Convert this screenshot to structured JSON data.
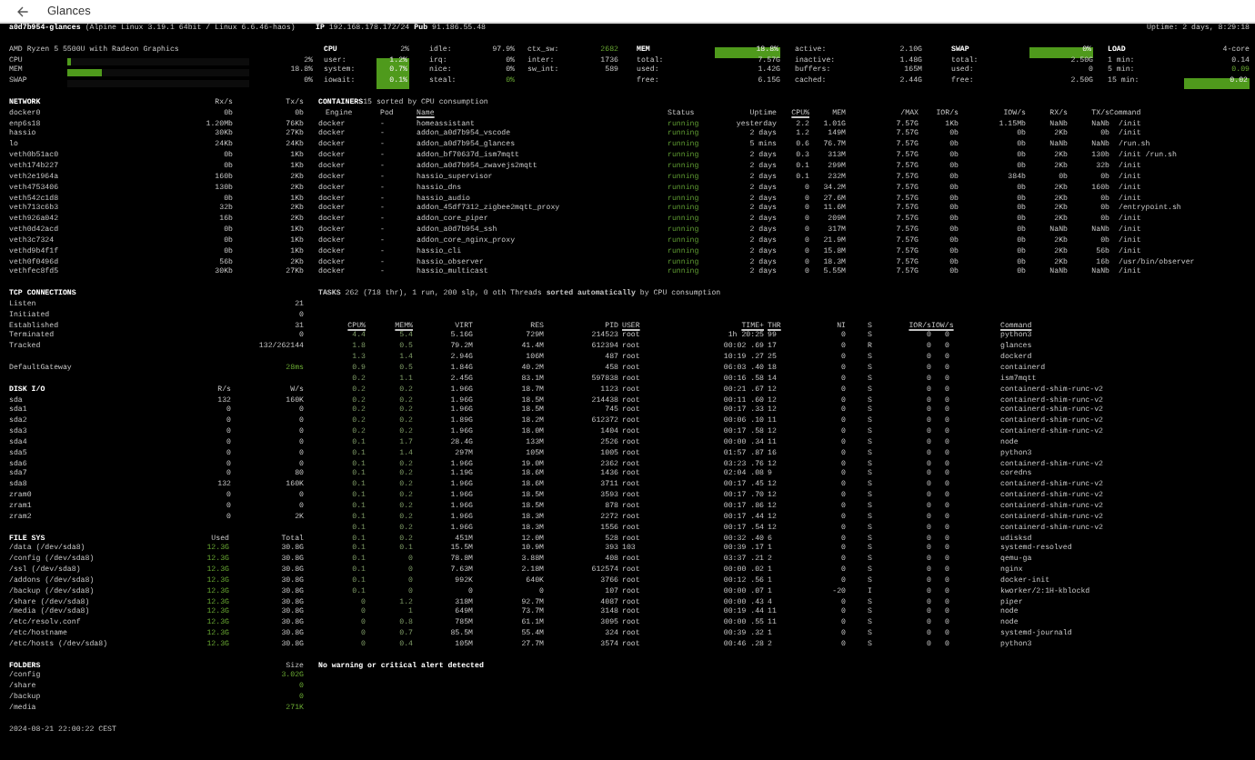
{
  "window": {
    "title": "Glances"
  },
  "header": {
    "hostname": "a0d7b954-glances",
    "os": "(Alpine Linux 3.19.1 64bit / Linux 6.6.46-haos)",
    "ip_label": "IP",
    "ip": "192.168.178.172/24",
    "pub_label": "Pub",
    "pub": "91.186.55.48",
    "uptime": "Uptime: 2 days, 8:29:18"
  },
  "quicklook": {
    "cpu_model": "AMD Ryzen 5 5500U with Radeon Graphics",
    "bars": [
      {
        "label": "CPU",
        "level": 0.02,
        "value": "2%"
      },
      {
        "label": "MEM",
        "level": 0.188,
        "value": "18.8%"
      },
      {
        "label": "SWAP",
        "level": 0,
        "value": "0%"
      }
    ]
  },
  "stats": [
    {
      "rows": [
        {
          "label": "CPU",
          "value": "2%",
          "kind": "plain",
          "heading": true
        },
        {
          "label": "user:",
          "value": "1.2%",
          "kind": "fill"
        },
        {
          "label": "system:",
          "value": "0.7%",
          "kind": "fill"
        },
        {
          "label": "iowait:",
          "value": "0.1%",
          "kind": "fill"
        }
      ]
    },
    {
      "rows": [
        {
          "label": "idle:",
          "value": "97.9%",
          "kind": "plain"
        },
        {
          "label": "irq:",
          "value": "0%",
          "kind": "plain"
        },
        {
          "label": "nice:",
          "value": "0%",
          "kind": "plain"
        },
        {
          "label": "steal:",
          "value": "0%",
          "kind": "ok"
        }
      ]
    },
    {
      "rows": [
        {
          "label": "ctx_sw:",
          "value": "2682",
          "kind": "ok"
        },
        {
          "label": "inter:",
          "value": "1736",
          "kind": "plain"
        },
        {
          "label": "sw_int:",
          "value": "589",
          "kind": "plain"
        }
      ]
    },
    {
      "rows": [
        {
          "label": "MEM",
          "value": "18.8%",
          "kind": "fill",
          "heading": true
        },
        {
          "label": "total:",
          "value": "7.57G",
          "kind": "plain"
        },
        {
          "label": "used:",
          "value": "1.42G",
          "kind": "plain"
        },
        {
          "label": "free:",
          "value": "6.15G",
          "kind": "plain"
        }
      ]
    },
    {
      "rows": [
        {
          "label": "active:",
          "value": "2.10G",
          "kind": "plain"
        },
        {
          "label": "inactive:",
          "value": "1.48G",
          "kind": "plain"
        },
        {
          "label": "buffers:",
          "value": "165M",
          "kind": "plain"
        },
        {
          "label": "cached:",
          "value": "2.44G",
          "kind": "plain"
        }
      ]
    },
    {
      "rows": [
        {
          "label": "SWAP",
          "value": "0%",
          "kind": "fill",
          "heading": true
        },
        {
          "label": "total:",
          "value": "2.50G",
          "kind": "plain"
        },
        {
          "label": "used:",
          "value": "0",
          "kind": "plain"
        },
        {
          "label": "free:",
          "value": "2.50G",
          "kind": "plain"
        }
      ]
    },
    {
      "rows": [
        {
          "label": "LOAD",
          "value": "4-core",
          "kind": "plain",
          "heading": true
        },
        {
          "label": "1 min:",
          "value": "0.14",
          "kind": "plain"
        },
        {
          "label": "5 min:",
          "value": "0.09",
          "kind": "ok"
        },
        {
          "label": "15 min:",
          "value": "0.02",
          "kind": "fill"
        }
      ]
    }
  ],
  "network": {
    "columns": [
      "NETWORK",
      "Rx/s",
      "Tx/s"
    ],
    "rows": [
      [
        "docker0",
        "0b",
        "0b"
      ],
      [
        "enp6s18",
        "1.20Mb",
        "76Kb"
      ],
      [
        "hassio",
        "30Kb",
        "27Kb"
      ],
      [
        "lo",
        "24Kb",
        "24Kb"
      ],
      [
        "veth0b51ac0",
        "0b",
        "1Kb"
      ],
      [
        "veth174b227",
        "0b",
        "1Kb"
      ],
      [
        "veth2e1964a",
        "160b",
        "2Kb"
      ],
      [
        "veth4753406",
        "130b",
        "2Kb"
      ],
      [
        "veth542c1d8",
        "0b",
        "1Kb"
      ],
      [
        "veth713c6b3",
        "32b",
        "2Kb"
      ],
      [
        "veth926a042",
        "16b",
        "2Kb"
      ],
      [
        "veth0d42acd",
        "0b",
        "1Kb"
      ],
      [
        "veth3c7324",
        "0b",
        "1Kb"
      ],
      [
        "vethd9b4f1f",
        "0b",
        "1Kb"
      ],
      [
        "veth0f0496d",
        "56b",
        "2Kb"
      ],
      [
        "vethfec8fd5",
        "30Kb",
        "27Kb"
      ]
    ]
  },
  "containers": {
    "title": "CONTAINERS",
    "summary": "15 sorted by CPU consumption",
    "columns": [
      {
        "label": "Engine",
        "underlined": false
      },
      {
        "label": "Pod",
        "underlined": false
      },
      {
        "label": "Name",
        "underlined": true
      },
      {
        "label": "Status",
        "underlined": false
      },
      {
        "label": "Uptime",
        "underlined": false
      },
      {
        "label": "CPU%",
        "underlined": true
      },
      {
        "label": "MEM",
        "underlined": false
      },
      {
        "label": "/MAX",
        "underlined": false
      },
      {
        "label": "IOR/s",
        "underlined": false
      },
      {
        "label": "IOW/s",
        "underlined": false
      },
      {
        "label": "RX/s",
        "underlined": false
      },
      {
        "label": "TX/s",
        "underlined": false
      },
      {
        "label": "Command",
        "underlined": false
      }
    ],
    "rows": [
      [
        "docker",
        "-",
        "homeassistant",
        "running",
        "yesterday",
        "2.2",
        "1.01G",
        "7.57G",
        "1Kb",
        "1.15Mb",
        "NaNb",
        "NaNb",
        "/init"
      ],
      [
        "docker",
        "-",
        "addon_a0d7b954_vscode",
        "running",
        "2 days",
        "1.2",
        "149M",
        "7.57G",
        "0b",
        "0b",
        "2Kb",
        "0b",
        "/init"
      ],
      [
        "docker",
        "-",
        "addon_a0d7b954_glances",
        "running",
        "5 mins",
        "0.6",
        "76.7M",
        "7.57G",
        "0b",
        "0b",
        "NaNb",
        "NaNb",
        "/run.sh"
      ],
      [
        "docker",
        "-",
        "addon_bf70637d_ism7mqtt",
        "running",
        "2 days",
        "0.3",
        "313M",
        "7.57G",
        "0b",
        "0b",
        "2Kb",
        "130b",
        "/init /run.sh"
      ],
      [
        "docker",
        "-",
        "addon_a0d7b954_zwavejs2mqtt",
        "running",
        "2 days",
        "0.1",
        "299M",
        "7.57G",
        "0b",
        "0b",
        "2Kb",
        "32b",
        "/init"
      ],
      [
        "docker",
        "-",
        "hassio_supervisor",
        "running",
        "2 days",
        "0.1",
        "232M",
        "7.57G",
        "0b",
        "384b",
        "0b",
        "0b",
        "/init"
      ],
      [
        "docker",
        "-",
        "hassio_dns",
        "running",
        "2 days",
        "0",
        "34.2M",
        "7.57G",
        "0b",
        "0b",
        "2Kb",
        "160b",
        "/init"
      ],
      [
        "docker",
        "-",
        "hassio_audio",
        "running",
        "2 days",
        "0",
        "27.6M",
        "7.57G",
        "0b",
        "0b",
        "2Kb",
        "0b",
        "/init"
      ],
      [
        "docker",
        "-",
        "addon_45df7312_zigbee2mqtt_proxy",
        "running",
        "2 days",
        "0",
        "11.6M",
        "7.57G",
        "0b",
        "0b",
        "2Kb",
        "0b",
        "/entrypoint.sh"
      ],
      [
        "docker",
        "-",
        "addon_core_piper",
        "running",
        "2 days",
        "0",
        "209M",
        "7.57G",
        "0b",
        "0b",
        "2Kb",
        "0b",
        "/init"
      ],
      [
        "docker",
        "-",
        "addon_a0d7b954_ssh",
        "running",
        "2 days",
        "0",
        "317M",
        "7.57G",
        "0b",
        "0b",
        "NaNb",
        "NaNb",
        "/init"
      ],
      [
        "docker",
        "-",
        "addon_core_nginx_proxy",
        "running",
        "2 days",
        "0",
        "21.9M",
        "7.57G",
        "0b",
        "0b",
        "2Kb",
        "0b",
        "/init"
      ],
      [
        "docker",
        "-",
        "hassio_cli",
        "running",
        "2 days",
        "0",
        "15.8M",
        "7.57G",
        "0b",
        "0b",
        "2Kb",
        "56b",
        "/init"
      ],
      [
        "docker",
        "-",
        "hassio_observer",
        "running",
        "2 days",
        "0",
        "18.3M",
        "7.57G",
        "0b",
        "0b",
        "2Kb",
        "16b",
        "/usr/bin/observer"
      ],
      [
        "docker",
        "-",
        "hassio_multicast",
        "running",
        "2 days",
        "0",
        "5.55M",
        "7.57G",
        "0b",
        "0b",
        "NaNb",
        "NaNb",
        "/init"
      ]
    ]
  },
  "tcp_connections": {
    "title": "TCP CONNECTIONS",
    "rows": [
      [
        "Listen",
        "21"
      ],
      [
        "Initiated",
        "0"
      ],
      [
        "Established",
        "31"
      ],
      [
        "Terminated",
        "0"
      ],
      [
        "Tracked",
        "132/262144"
      ]
    ],
    "gateway": [
      "DefaultGateway",
      "28ms"
    ]
  },
  "disk_io": {
    "columns": [
      "DISK I/O",
      "R/s",
      "W/s"
    ],
    "rows": [
      [
        "sda",
        "132",
        "160K"
      ],
      [
        "sda1",
        "0",
        "0"
      ],
      [
        "sda2",
        "0",
        "0"
      ],
      [
        "sda3",
        "0",
        "0"
      ],
      [
        "sda4",
        "0",
        "0"
      ],
      [
        "sda5",
        "0",
        "0"
      ],
      [
        "sda6",
        "0",
        "0"
      ],
      [
        "sda7",
        "0",
        "80"
      ],
      [
        "sda8",
        "132",
        "160K"
      ],
      [
        "zram0",
        "0",
        "0"
      ],
      [
        "zram1",
        "0",
        "0"
      ],
      [
        "zram2",
        "0",
        "2K"
      ]
    ]
  },
  "file_sys": {
    "columns": [
      "FILE SYS",
      "Used",
      "Total"
    ],
    "rows": [
      [
        "/data (/dev/sda8)",
        "12.3G",
        "30.8G"
      ],
      [
        "/config (/dev/sda8)",
        "12.3G",
        "30.8G"
      ],
      [
        "/ssl (/dev/sda8)",
        "12.3G",
        "30.8G"
      ],
      [
        "/addons (/dev/sda8)",
        "12.3G",
        "30.8G"
      ],
      [
        "/backup (/dev/sda8)",
        "12.3G",
        "30.8G"
      ],
      [
        "/share (/dev/sda8)",
        "12.3G",
        "30.8G"
      ],
      [
        "/media (/dev/sda8)",
        "12.3G",
        "30.8G"
      ],
      [
        "/etc/resolv.conf",
        "12.3G",
        "30.8G"
      ],
      [
        "/etc/hostname",
        "12.3G",
        "30.8G"
      ],
      [
        "/etc/hosts (/dev/sda8)",
        "12.3G",
        "30.8G"
      ]
    ]
  },
  "folders": {
    "columns": [
      "FOLDERS",
      "Size"
    ],
    "rows": [
      [
        "/config",
        "3.02G"
      ],
      [
        "/share",
        "0"
      ],
      [
        "/backup",
        "0"
      ],
      [
        "/media",
        "271K"
      ]
    ]
  },
  "footer": "2024-08-21 22:00:22 CEST",
  "tasks": "**TASKS** 262 (718 thr), 1 run, 200 slp, 0 oth Threads **sorted automatically** by CPU consumption",
  "processes": {
    "columns": [
      {
        "label": "CPU%",
        "underlined": true
      },
      {
        "label": "MEM%",
        "underlined": true
      },
      {
        "label": "VIRT",
        "underlined": false
      },
      {
        "label": "RES",
        "underlined": false
      },
      {
        "label": "PID",
        "underlined": false
      },
      {
        "label": "USER",
        "underlined": true
      },
      {
        "label": "TIME+",
        "underlined": true
      },
      {
        "label": "THR",
        "underlined": true
      },
      {
        "label": "NI",
        "underlined": false
      },
      {
        "label": "S",
        "underlined": false
      },
      {
        "label": "IOR/s",
        "underlined": true
      },
      {
        "label": "IOW/s",
        "underlined": true
      },
      {
        "label": "Command",
        "underlined": true
      }
    ],
    "rows": [
      [
        "4.4",
        "5.4",
        "5.16G",
        "729M",
        "214523",
        "root",
        "1h 20:25",
        "99",
        "0",
        "S",
        "0",
        "0",
        "python3"
      ],
      [
        "1.8",
        "0.5",
        "79.2M",
        "41.4M",
        "612394",
        "root",
        "00:02 .69",
        "17",
        "0",
        "R",
        "0",
        "0",
        "glances"
      ],
      [
        "1.3",
        "1.4",
        "2.94G",
        "106M",
        "487",
        "root",
        "10:19 .27",
        "25",
        "0",
        "S",
        "0",
        "0",
        "dockerd"
      ],
      [
        "0.9",
        "0.5",
        "1.84G",
        "40.2M",
        "458",
        "root",
        "06:03 .40",
        "18",
        "0",
        "S",
        "0",
        "0",
        "containerd"
      ],
      [
        "0.2",
        "1.1",
        "2.45G",
        "83.1M",
        "597838",
        "root",
        "00:16 .58",
        "14",
        "0",
        "S",
        "0",
        "0",
        "ism7mqtt"
      ],
      [
        "0.2",
        "0.2",
        "1.96G",
        "18.7M",
        "1123",
        "root",
        "00:21 .67",
        "12",
        "0",
        "S",
        "0",
        "0",
        "containerd-shim-runc-v2"
      ],
      [
        "0.2",
        "0.2",
        "1.96G",
        "18.5M",
        "214438",
        "root",
        "00:11 .60",
        "12",
        "0",
        "S",
        "0",
        "0",
        "containerd-shim-runc-v2"
      ],
      [
        "0.2",
        "0.2",
        "1.96G",
        "18.5M",
        "745",
        "root",
        "00:17 .33",
        "12",
        "0",
        "S",
        "0",
        "0",
        "containerd-shim-runc-v2"
      ],
      [
        "0.2",
        "0.2",
        "1.89G",
        "18.2M",
        "612372",
        "root",
        "00:06 .10",
        "11",
        "0",
        "S",
        "0",
        "0",
        "containerd-shim-runc-v2"
      ],
      [
        "0.2",
        "0.2",
        "1.96G",
        "18.0M",
        "1404",
        "root",
        "00:17 .58",
        "12",
        "0",
        "S",
        "0",
        "0",
        "containerd-shim-runc-v2"
      ],
      [
        "0.1",
        "1.7",
        "28.4G",
        "133M",
        "2526",
        "root",
        "00:00 .34",
        "11",
        "0",
        "S",
        "0",
        "0",
        "node"
      ],
      [
        "0.1",
        "1.4",
        "297M",
        "105M",
        "1005",
        "root",
        "01:57 .87",
        "16",
        "0",
        "S",
        "0",
        "0",
        "python3"
      ],
      [
        "0.1",
        "0.2",
        "1.96G",
        "19.0M",
        "2362",
        "root",
        "03:23 .76",
        "12",
        "0",
        "S",
        "0",
        "0",
        "containerd-shim-runc-v2"
      ],
      [
        "0.1",
        "0.2",
        "1.19G",
        "18.6M",
        "1436",
        "root",
        "02:04 .08",
        "9",
        "0",
        "S",
        "0",
        "0",
        "coredns"
      ],
      [
        "0.1",
        "0.2",
        "1.96G",
        "18.6M",
        "3711",
        "root",
        "00:17 .45",
        "12",
        "0",
        "S",
        "0",
        "0",
        "containerd-shim-runc-v2"
      ],
      [
        "0.1",
        "0.2",
        "1.96G",
        "18.5M",
        "3593",
        "root",
        "00:17 .70",
        "12",
        "0",
        "S",
        "0",
        "0",
        "containerd-shim-runc-v2"
      ],
      [
        "0.1",
        "0.2",
        "1.96G",
        "18.5M",
        "878",
        "root",
        "00:17 .86",
        "12",
        "0",
        "S",
        "0",
        "0",
        "containerd-shim-runc-v2"
      ],
      [
        "0.1",
        "0.2",
        "1.96G",
        "18.3M",
        "2272",
        "root",
        "00:17 .44",
        "12",
        "0",
        "S",
        "0",
        "0",
        "containerd-shim-runc-v2"
      ],
      [
        "0.1",
        "0.2",
        "1.96G",
        "18.3M",
        "1556",
        "root",
        "00:17 .54",
        "12",
        "0",
        "S",
        "0",
        "0",
        "containerd-shim-runc-v2"
      ],
      [
        "0.1",
        "0.2",
        "451M",
        "12.0M",
        "528",
        "root",
        "00:32 .40",
        "6",
        "0",
        "S",
        "0",
        "0",
        "udisksd"
      ],
      [
        "0.1",
        "0.1",
        "15.5M",
        "10.9M",
        "393",
        "103",
        "00:39 .17",
        "1",
        "0",
        "S",
        "0",
        "0",
        "systemd-resolved"
      ],
      [
        "0.1",
        "0",
        "78.8M",
        "3.88M",
        "408",
        "root",
        "03:37 .21",
        "2",
        "0",
        "S",
        "0",
        "0",
        "qemu-ga"
      ],
      [
        "0.1",
        "0",
        "7.63M",
        "2.18M",
        "612574",
        "root",
        "00:00 .02",
        "1",
        "0",
        "S",
        "0",
        "0",
        "nginx"
      ],
      [
        "0.1",
        "0",
        "992K",
        "640K",
        "3766",
        "root",
        "00:12 .56",
        "1",
        "0",
        "S",
        "0",
        "0",
        "docker-init"
      ],
      [
        "0.1",
        "0",
        "0",
        "0",
        "107",
        "root",
        "00:00 .07",
        "1",
        "-20",
        "I",
        "0",
        "0",
        "kworker/2:1H-kblockd"
      ],
      [
        "0",
        "1.2",
        "318M",
        "92.7M",
        "4087",
        "root",
        "00:00 .43",
        "4",
        "0",
        "S",
        "0",
        "0",
        "piper"
      ],
      [
        "0",
        "1",
        "649M",
        "73.7M",
        "3148",
        "root",
        "00:19 .44",
        "11",
        "0",
        "S",
        "0",
        "0",
        "node"
      ],
      [
        "0",
        "0.8",
        "785M",
        "61.1M",
        "3095",
        "root",
        "00:00 .55",
        "11",
        "0",
        "S",
        "0",
        "0",
        "node"
      ],
      [
        "0",
        "0.7",
        "85.5M",
        "55.4M",
        "324",
        "root",
        "00:39 .32",
        "1",
        "0",
        "S",
        "0",
        "0",
        "systemd-journald"
      ],
      [
        "0",
        "0.4",
        "105M",
        "27.7M",
        "3574",
        "root",
        "00:46 .28",
        "2",
        "0",
        "S",
        "0",
        "0",
        "python3"
      ]
    ]
  },
  "alert": "No warning or critical alert detected"
}
